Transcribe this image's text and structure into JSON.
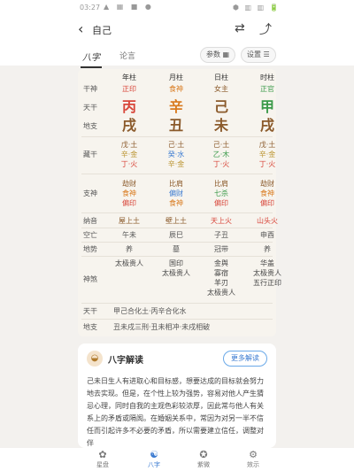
{
  "status": {
    "time": "03:27",
    "icons": "▲ ▦ ■ ●",
    "right": "⬢ ▥ ▥ 🔋"
  },
  "header": {
    "title": "自己",
    "back": "‹",
    "swap": "⇄",
    "share": "⤴"
  },
  "tabs": {
    "bazi": "八字",
    "second": "论言",
    "params": "参数",
    "settings": "设置"
  },
  "table": {
    "headers": [
      "年柱",
      "月柱",
      "日柱",
      "时柱"
    ],
    "row_labels": [
      "干神",
      "天干",
      "地支",
      "藏干",
      "支神",
      "纳音",
      "空亡",
      "地势",
      "神煞",
      "天干",
      "地支"
    ],
    "ganshen": [
      "正印",
      "食神",
      "女主",
      "正官"
    ],
    "tiangan": [
      "丙",
      "辛",
      "己",
      "甲"
    ],
    "dizhi": [
      "戌",
      "丑",
      "未",
      "戌"
    ],
    "canggan": [
      [
        "戊·土",
        "辛·金",
        "丁·火"
      ],
      [
        "己·土",
        "癸·水",
        "辛·金"
      ],
      [
        "己·土",
        "乙·木",
        "丁·火"
      ],
      [
        "戊·土",
        "辛·金",
        "丁·火"
      ]
    ],
    "zhishen": [
      [
        "劫财",
        "食神",
        "偏印"
      ],
      [
        "比肩",
        "偏财",
        "食神"
      ],
      [
        "比肩",
        "七杀",
        "偏印"
      ],
      [
        "劫财",
        "食神",
        "偏印"
      ]
    ],
    "nayin": [
      "屋上土",
      "壁上土",
      "天上火",
      "山头火"
    ],
    "kongwang": [
      "午未",
      "辰巳",
      "子丑",
      "申酉"
    ],
    "dishi": [
      "养",
      "墓",
      "冠带",
      "养"
    ],
    "shensha": [
      [
        "太极贵人"
      ],
      [
        "国印",
        "太极贵人"
      ],
      [
        "金舆",
        "寡宿",
        "羊刃",
        "太极贵人"
      ],
      [
        "华盖",
        "太极贵人",
        "五行正印"
      ]
    ],
    "tiangan_note": "甲己合化土·丙辛合化水",
    "dizhi_note": "丑未戌三刑·丑未相冲·未戌相破"
  },
  "reading": {
    "title": "八字解读",
    "more": "更多解读",
    "text": "己未日生人有进取心和目标感，想要达成的目标就会努力地去实现。但是，在个性上较为强势，容易对他人产生猜忌心理，同时自我的主观色彩较浓厚，因此常与他人有关系上的矛盾或隔阂。在婚姻关系中，常因为对另一半不信任而引起许多不必要的矛盾，所以需要建立信任，调整对伴"
  },
  "nav": [
    {
      "label": "星盘",
      "icon": "✿"
    },
    {
      "label": "八字",
      "icon": "☯"
    },
    {
      "label": "紫微",
      "icon": "✪"
    },
    {
      "label": "效示",
      "icon": "⚙"
    }
  ]
}
